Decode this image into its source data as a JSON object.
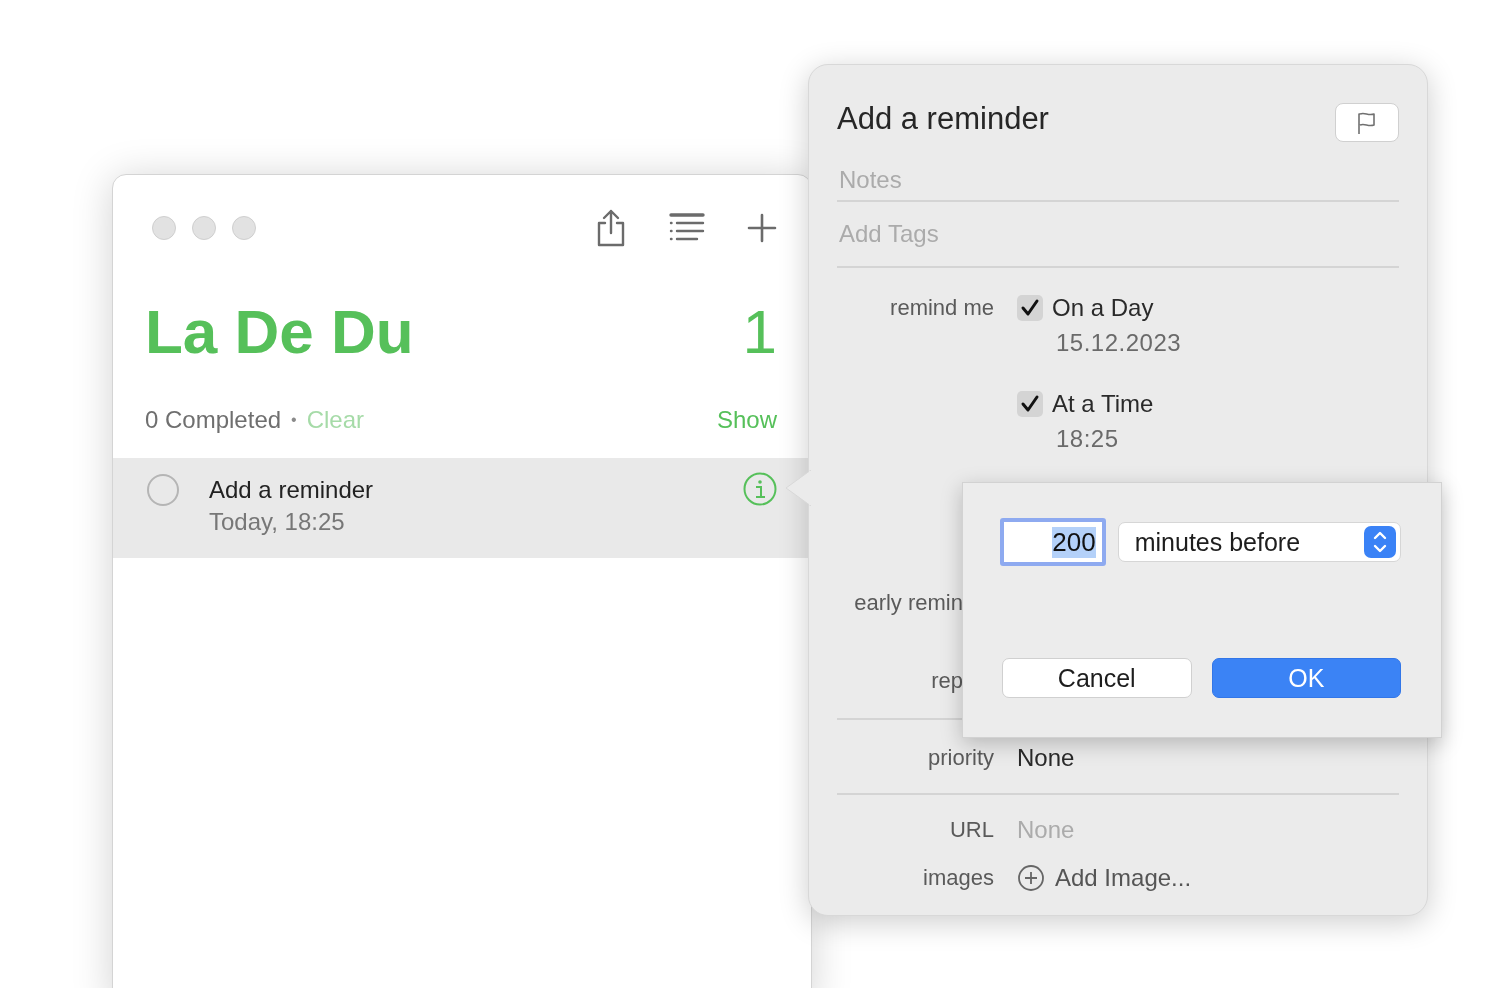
{
  "list_window": {
    "title": "La De Du",
    "count": "1",
    "completed": "0 Completed",
    "separator": "•",
    "clear": "Clear",
    "show": "Show",
    "reminders": [
      {
        "title": "Add a reminder",
        "subtitle": "Today, 18:25",
        "selected": true,
        "completed": false
      }
    ]
  },
  "detail": {
    "title": "Add a reminder",
    "flagged": false,
    "notes_placeholder": "Notes",
    "tags_placeholder": "Add Tags",
    "remind_label": "remind me",
    "options": [
      {
        "label": "On a Day",
        "checked": true,
        "value": "15.12.2023"
      },
      {
        "label": "At a Time",
        "checked": true,
        "value": "18:25"
      }
    ],
    "partial_labels": [
      "early remin",
      "rep"
    ],
    "priority": {
      "label": "priority",
      "value": "None"
    },
    "url": {
      "label": "URL",
      "placeholder": "None"
    },
    "images": {
      "label": "images",
      "action": "Add Image..."
    }
  },
  "early_reminder_sheet": {
    "amount": "200",
    "amount_selected": true,
    "unit": "minutes before",
    "buttons": [
      {
        "label": "Cancel",
        "kind": "secondary"
      },
      {
        "label": "OK",
        "kind": "primary"
      }
    ]
  }
}
